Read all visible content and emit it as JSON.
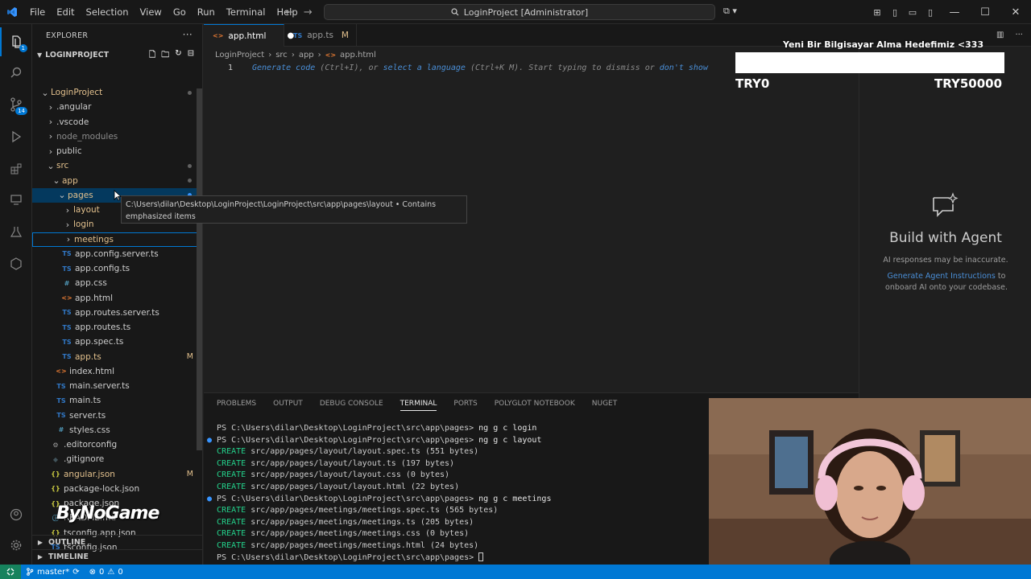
{
  "titlebar": {
    "menu": [
      "File",
      "Edit",
      "Selection",
      "View",
      "Go",
      "Run",
      "Terminal",
      "Help"
    ],
    "command_center": "LoginProject [Administrator]"
  },
  "sidebar": {
    "title": "EXPLORER",
    "project": "LOGINPROJECT",
    "tree": [
      {
        "label": "LoginProject",
        "depth": 1,
        "kind": "folder-open",
        "color": "#e2c08d",
        "dot": true
      },
      {
        "label": ".angular",
        "depth": 2,
        "kind": "folder",
        "color": "#cccccc"
      },
      {
        "label": ".vscode",
        "depth": 2,
        "kind": "folder",
        "color": "#cccccc"
      },
      {
        "label": "node_modules",
        "depth": 2,
        "kind": "folder",
        "color": "#8c8c8c"
      },
      {
        "label": "public",
        "depth": 2,
        "kind": "folder",
        "color": "#cccccc"
      },
      {
        "label": "src",
        "depth": 2,
        "kind": "folder-open",
        "color": "#e2c08d",
        "dot": true
      },
      {
        "label": "app",
        "depth": 3,
        "kind": "folder-open",
        "color": "#e2c08d",
        "dot": true
      },
      {
        "label": "pages",
        "depth": 4,
        "kind": "folder-open",
        "color": "#e2c08d",
        "dot": true,
        "dot_blue": true,
        "selected": true
      },
      {
        "label": "layout",
        "depth": 5,
        "kind": "folder",
        "color": "#e2c08d",
        "dot": true
      },
      {
        "label": "login",
        "depth": 5,
        "kind": "folder",
        "color": "#e2c08d"
      },
      {
        "label": "meetings",
        "depth": 5,
        "kind": "folder",
        "color": "#e2c08d",
        "outlined": true
      },
      {
        "label": "app.config.server.ts",
        "depth": 4,
        "kind": "ts",
        "color": "#cccccc"
      },
      {
        "label": "app.config.ts",
        "depth": 4,
        "kind": "ts",
        "color": "#cccccc"
      },
      {
        "label": "app.css",
        "depth": 4,
        "kind": "css",
        "color": "#cccccc"
      },
      {
        "label": "app.html",
        "depth": 4,
        "kind": "html",
        "color": "#cccccc"
      },
      {
        "label": "app.routes.server.ts",
        "depth": 4,
        "kind": "ts",
        "color": "#cccccc"
      },
      {
        "label": "app.routes.ts",
        "depth": 4,
        "kind": "ts",
        "color": "#cccccc"
      },
      {
        "label": "app.spec.ts",
        "depth": 4,
        "kind": "ts",
        "color": "#cccccc"
      },
      {
        "label": "app.ts",
        "depth": 4,
        "kind": "ts",
        "color": "#e2c08d",
        "flag": "M"
      },
      {
        "label": "index.html",
        "depth": 3,
        "kind": "html",
        "color": "#cccccc"
      },
      {
        "label": "main.server.ts",
        "depth": 3,
        "kind": "ts",
        "color": "#cccccc"
      },
      {
        "label": "main.ts",
        "depth": 3,
        "kind": "ts",
        "color": "#cccccc"
      },
      {
        "label": "server.ts",
        "depth": 3,
        "kind": "ts",
        "color": "#cccccc"
      },
      {
        "label": "styles.css",
        "depth": 3,
        "kind": "css",
        "color": "#cccccc"
      },
      {
        "label": ".editorconfig",
        "depth": 2,
        "kind": "gear",
        "color": "#cccccc"
      },
      {
        "label": ".gitignore",
        "depth": 2,
        "kind": "git",
        "color": "#cccccc"
      },
      {
        "label": "angular.json",
        "depth": 2,
        "kind": "json",
        "color": "#e2c08d",
        "flag": "M"
      },
      {
        "label": "package-lock.json",
        "depth": 2,
        "kind": "json",
        "color": "#cccccc"
      },
      {
        "label": "package.json",
        "depth": 2,
        "kind": "json",
        "color": "#cccccc"
      },
      {
        "label": "README.md",
        "depth": 2,
        "kind": "info",
        "color": "#cccccc"
      },
      {
        "label": "tsconfig.app.json",
        "depth": 2,
        "kind": "json",
        "color": "#cccccc"
      },
      {
        "label": "tsconfig.json",
        "depth": 2,
        "kind": "ts",
        "color": "#cccccc"
      }
    ],
    "tooltip_line1": "C:\\Users\\dilar\\Desktop\\LoginProject\\LoginProject\\src\\app\\pages\\layout • Contains",
    "tooltip_line2": "emphasized items",
    "outline": "OUTLINE",
    "timeline": "TIMELINE"
  },
  "tabs": [
    {
      "label": "app.html",
      "icon": "<>",
      "active": true,
      "modified_dot": "●"
    },
    {
      "label": "app.ts",
      "icon": "TS",
      "active": false,
      "flag": "M"
    }
  ],
  "breadcrumb": [
    "LoginProject",
    "src",
    "app",
    "app.html"
  ],
  "editor": {
    "line_number": "1",
    "hint_parts": [
      "Generate code",
      " (Ctrl+I), or ",
      "select a language",
      " (Ctrl+K M). Start typing to dismiss or ",
      "don't show"
    ]
  },
  "overlay": {
    "title": "Yeni Bir Bilgisayar Alma Hedefimiz <333",
    "min": "TRY0",
    "max": "TRY50000",
    "progress": 0
  },
  "chat": {
    "heading": "Build with Agent",
    "note": "AI responses may be inaccurate.",
    "link": "Generate Agent Instructions",
    "tail1": " to",
    "tail2": "onboard AI onto your codebase."
  },
  "panel": {
    "tabs": [
      "PROBLEMS",
      "OUTPUT",
      "DEBUG CONSOLE",
      "TERMINAL",
      "PORTS",
      "POLYGLOT NOTEBOOK",
      "NUGET"
    ],
    "active_tab": "TERMINAL",
    "terminal": [
      {
        "kind": "prompt",
        "bullet": false,
        "text": "PS C:\\Users\\dilar\\Desktop\\LoginProject\\src\\app\\pages> ",
        "cmd": "ng g c login"
      },
      {
        "kind": "prompt",
        "bullet": true,
        "text": "PS C:\\Users\\dilar\\Desktop\\LoginProject\\src\\app\\pages> ",
        "cmd": "ng g c layout"
      },
      {
        "kind": "create",
        "text": "src/app/pages/layout/layout.spec.ts (551 bytes)"
      },
      {
        "kind": "create",
        "text": "src/app/pages/layout/layout.ts (197 bytes)"
      },
      {
        "kind": "create",
        "text": "src/app/pages/layout/layout.css (0 bytes)"
      },
      {
        "kind": "create",
        "text": "src/app/pages/layout/layout.html (22 bytes)"
      },
      {
        "kind": "prompt",
        "bullet": true,
        "text": "PS C:\\Users\\dilar\\Desktop\\LoginProject\\src\\app\\pages> ",
        "cmd": "ng g c meetings"
      },
      {
        "kind": "create",
        "text": "src/app/pages/meetings/meetings.spec.ts (565 bytes)"
      },
      {
        "kind": "create",
        "text": "src/app/pages/meetings/meetings.ts (205 bytes)"
      },
      {
        "kind": "create",
        "text": "src/app/pages/meetings/meetings.css (0 bytes)"
      },
      {
        "kind": "create",
        "text": "src/app/pages/meetings/meetings.html (24 bytes)"
      },
      {
        "kind": "prompt",
        "bullet": false,
        "text": "PS C:\\Users\\dilar\\Desktop\\LoginProject\\src\\app\\pages> ",
        "cmd": "",
        "cursor": true
      }
    ]
  },
  "watermark": "ByNoGame",
  "statusbar": {
    "branch": "master*",
    "errors": "0",
    "warnings": "0"
  },
  "colors": {
    "accent": "#0078d4",
    "modified": "#e2c08d",
    "terminal_create": "#23d18b"
  }
}
